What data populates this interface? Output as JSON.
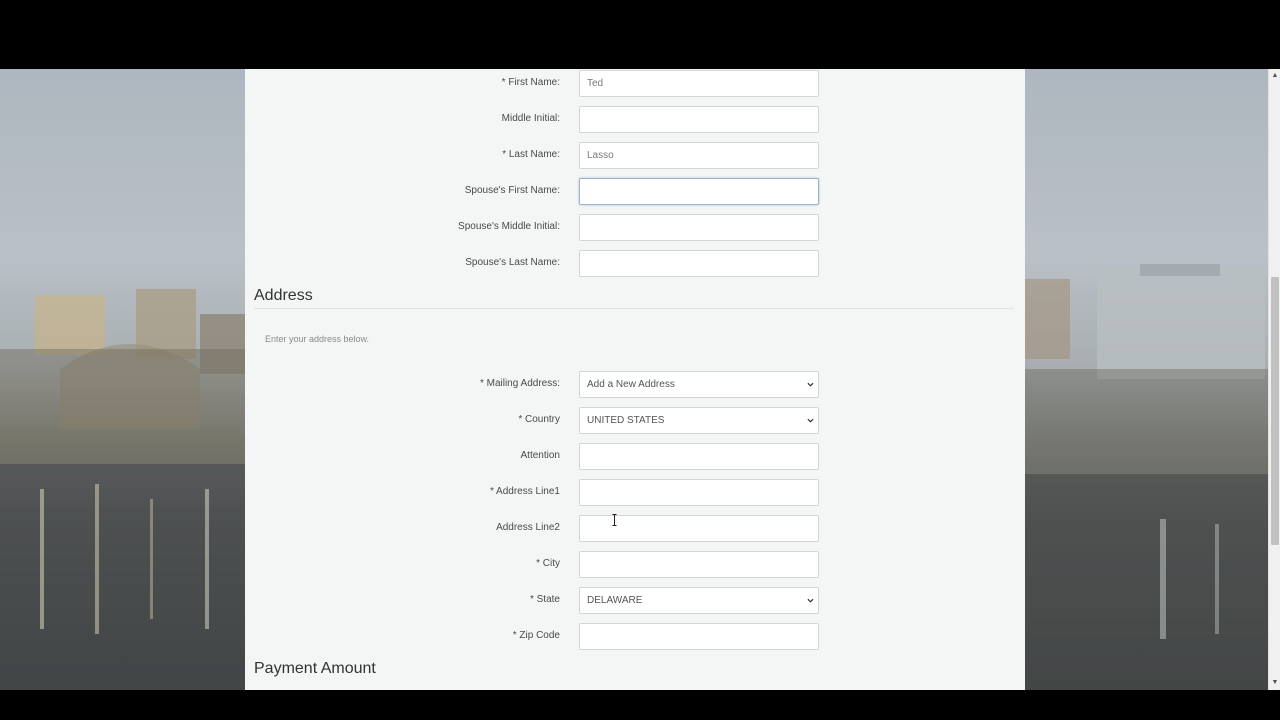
{
  "personal": {
    "first_name": {
      "label": "* First Name:",
      "value": "Ted"
    },
    "middle_initial": {
      "label": "Middle Initial:",
      "value": ""
    },
    "last_name": {
      "label": "* Last Name:",
      "value": "Lasso"
    },
    "spouse_first_name": {
      "label": "Spouse's First Name:",
      "value": ""
    },
    "spouse_middle_initial": {
      "label": "Spouse's Middle Initial:",
      "value": ""
    },
    "spouse_last_name": {
      "label": "Spouse's Last Name:",
      "value": ""
    }
  },
  "address": {
    "title": "Address",
    "helper": "Enter your address below.",
    "mailing_address": {
      "label": "* Mailing Address:",
      "value": "Add a New Address"
    },
    "country": {
      "label": "* Country",
      "value": "UNITED STATES"
    },
    "attention": {
      "label": "Attention",
      "value": ""
    },
    "line1": {
      "label": "* Address Line1",
      "value": ""
    },
    "line2": {
      "label": "Address Line2",
      "value": ""
    },
    "city": {
      "label": "* City",
      "value": ""
    },
    "state": {
      "label": "* State",
      "value": "DELAWARE"
    },
    "zip": {
      "label": "* Zip Code",
      "value": ""
    }
  },
  "payment": {
    "title": "Payment Amount"
  },
  "icons": {
    "select_chevron": "chevron-down-icon",
    "cursor": "text-cursor-icon",
    "scroll_up": "scroll-up-arrow",
    "scroll_down": "scroll-down-arrow"
  },
  "colors": {
    "panel_bg": "#f4f5f5",
    "field_border": "#d3d6d8",
    "focus_border": "#9fb3c8"
  }
}
